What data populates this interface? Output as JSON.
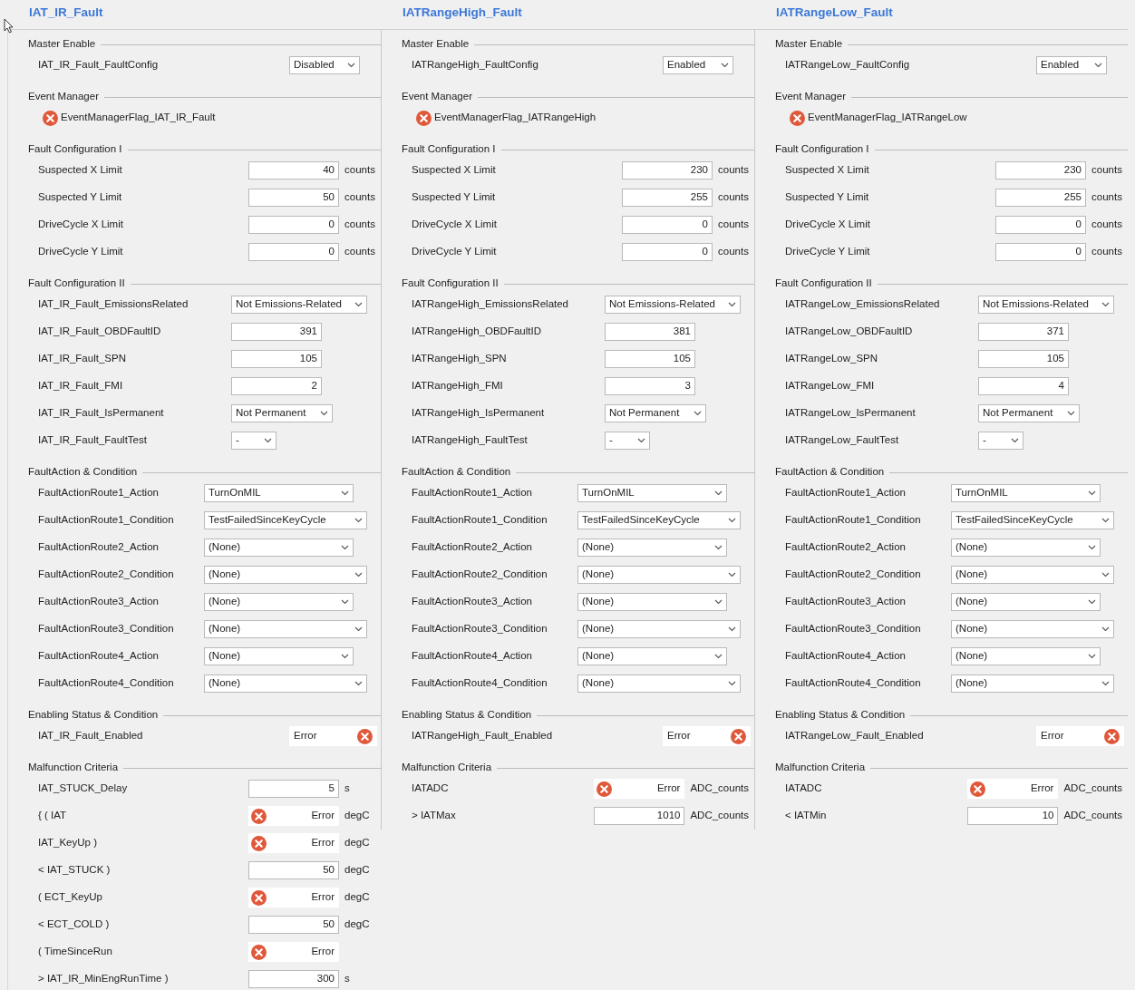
{
  "panels": [
    {
      "title": "IAT_IR_Fault",
      "sections": [
        {
          "title": "Master Enable",
          "rows": [
            {
              "kind": "select",
              "label": "IAT_IR_Fault_FaultConfig",
              "value": "Disabled"
            }
          ]
        },
        {
          "title": "Event Manager",
          "rows": [
            {
              "kind": "flag",
              "label": "EventManagerFlag_IAT_IR_Fault"
            }
          ]
        },
        {
          "title": "Fault Configuration I",
          "rows": [
            {
              "kind": "number",
              "label": "Suspected X Limit",
              "value": "40",
              "unit": "counts"
            },
            {
              "kind": "number",
              "label": "Suspected Y Limit",
              "value": "50",
              "unit": "counts"
            },
            {
              "kind": "number",
              "label": "DriveCycle X Limit",
              "value": "0",
              "unit": "counts"
            },
            {
              "kind": "number",
              "label": "DriveCycle Y Limit",
              "value": "0",
              "unit": "counts"
            }
          ]
        },
        {
          "title": "Fault Configuration II",
          "rows": [
            {
              "kind": "select",
              "label": "IAT_IR_Fault_EmissionsRelated",
              "value": "Not Emissions-Related"
            },
            {
              "kind": "number",
              "label": "IAT_IR_Fault_OBDFaultID",
              "value": "391"
            },
            {
              "kind": "number",
              "label": "IAT_IR_Fault_SPN",
              "value": "105"
            },
            {
              "kind": "number",
              "label": "IAT_IR_Fault_FMI",
              "value": "2"
            },
            {
              "kind": "select",
              "label": "IAT_IR_Fault_IsPermanent",
              "value": "Not Permanent"
            },
            {
              "kind": "select",
              "label": "IAT_IR_Fault_FaultTest",
              "value": "-"
            }
          ]
        },
        {
          "title": "FaultAction & Condition",
          "rows": [
            {
              "kind": "select",
              "label": "FaultActionRoute1_Action",
              "value": "TurnOnMIL"
            },
            {
              "kind": "select",
              "label": "FaultActionRoute1_Condition",
              "value": "TestFailedSinceKeyCycle"
            },
            {
              "kind": "select",
              "label": "FaultActionRoute2_Action",
              "value": "(None)"
            },
            {
              "kind": "select",
              "label": "FaultActionRoute2_Condition",
              "value": "(None)"
            },
            {
              "kind": "select",
              "label": "FaultActionRoute3_Action",
              "value": "(None)"
            },
            {
              "kind": "select",
              "label": "FaultActionRoute3_Condition",
              "value": "(None)"
            },
            {
              "kind": "select",
              "label": "FaultActionRoute4_Action",
              "value": "(None)"
            },
            {
              "kind": "select",
              "label": "FaultActionRoute4_Condition",
              "value": "(None)"
            }
          ]
        },
        {
          "title": "Enabling Status & Condition",
          "rows": [
            {
              "kind": "status",
              "label": "IAT_IR_Fault_Enabled",
              "value": "Error"
            }
          ]
        },
        {
          "title": "Malfunction Criteria",
          "rows": [
            {
              "kind": "number",
              "label": "IAT_STUCK_Delay",
              "value": "5",
              "unit": "s"
            },
            {
              "kind": "error_value",
              "label": "{ ( IAT",
              "value": "Error",
              "unit": "degC"
            },
            {
              "kind": "error_value",
              "label": "IAT_KeyUp )",
              "value": "Error",
              "unit": "degC"
            },
            {
              "kind": "number",
              "label": "< IAT_STUCK )",
              "value": "50",
              "unit": "degC"
            },
            {
              "kind": "error_value",
              "label": "( ECT_KeyUp",
              "value": "Error",
              "unit": "degC"
            },
            {
              "kind": "number",
              "label": "< ECT_COLD )",
              "value": "50",
              "unit": "degC"
            },
            {
              "kind": "error_value",
              "label": "( TimeSinceRun",
              "value": "Error"
            },
            {
              "kind": "number",
              "label": "> IAT_IR_MinEngRunTime )",
              "value": "300",
              "unit": "s"
            }
          ]
        }
      ]
    },
    {
      "title": "IATRangeHigh_Fault",
      "sections": [
        {
          "title": "Master Enable",
          "rows": [
            {
              "kind": "select",
              "label": "IATRangeHigh_FaultConfig",
              "value": "Enabled"
            }
          ]
        },
        {
          "title": "Event Manager",
          "rows": [
            {
              "kind": "flag",
              "label": "EventManagerFlag_IATRangeHigh"
            }
          ]
        },
        {
          "title": "Fault Configuration I",
          "rows": [
            {
              "kind": "number",
              "label": "Suspected X Limit",
              "value": "230",
              "unit": "counts"
            },
            {
              "kind": "number",
              "label": "Suspected Y Limit",
              "value": "255",
              "unit": "counts"
            },
            {
              "kind": "number",
              "label": "DriveCycle X Limit",
              "value": "0",
              "unit": "counts"
            },
            {
              "kind": "number",
              "label": "DriveCycle Y Limit",
              "value": "0",
              "unit": "counts"
            }
          ]
        },
        {
          "title": "Fault Configuration II",
          "rows": [
            {
              "kind": "select",
              "label": "IATRangeHigh_EmissionsRelated",
              "value": "Not Emissions-Related"
            },
            {
              "kind": "number",
              "label": "IATRangeHigh_OBDFaultID",
              "value": "381"
            },
            {
              "kind": "number",
              "label": "IATRangeHigh_SPN",
              "value": "105"
            },
            {
              "kind": "number",
              "label": "IATRangeHigh_FMI",
              "value": "3"
            },
            {
              "kind": "select",
              "label": "IATRangeHigh_IsPermanent",
              "value": "Not Permanent"
            },
            {
              "kind": "select",
              "label": "IATRangeHigh_FaultTest",
              "value": "-"
            }
          ]
        },
        {
          "title": "FaultAction & Condition",
          "rows": [
            {
              "kind": "select",
              "label": "FaultActionRoute1_Action",
              "value": "TurnOnMIL"
            },
            {
              "kind": "select",
              "label": "FaultActionRoute1_Condition",
              "value": "TestFailedSinceKeyCycle"
            },
            {
              "kind": "select",
              "label": "FaultActionRoute2_Action",
              "value": "(None)"
            },
            {
              "kind": "select",
              "label": "FaultActionRoute2_Condition",
              "value": "(None)"
            },
            {
              "kind": "select",
              "label": "FaultActionRoute3_Action",
              "value": "(None)"
            },
            {
              "kind": "select",
              "label": "FaultActionRoute3_Condition",
              "value": "(None)"
            },
            {
              "kind": "select",
              "label": "FaultActionRoute4_Action",
              "value": "(None)"
            },
            {
              "kind": "select",
              "label": "FaultActionRoute4_Condition",
              "value": "(None)"
            }
          ]
        },
        {
          "title": "Enabling Status & Condition",
          "rows": [
            {
              "kind": "status",
              "label": "IATRangeHigh_Fault_Enabled",
              "value": "Error"
            }
          ]
        },
        {
          "title": "Malfunction Criteria",
          "rows": [
            {
              "kind": "error_value",
              "label": "IATADC",
              "value": "Error",
              "unit": "ADC_counts"
            },
            {
              "kind": "number",
              "label": "> IATMax",
              "value": "1010",
              "unit": "ADC_counts"
            }
          ]
        }
      ]
    },
    {
      "title": "IATRangeLow_Fault",
      "sections": [
        {
          "title": "Master Enable",
          "rows": [
            {
              "kind": "select",
              "label": "IATRangeLow_FaultConfig",
              "value": "Enabled"
            }
          ]
        },
        {
          "title": "Event Manager",
          "rows": [
            {
              "kind": "flag",
              "label": "EventManagerFlag_IATRangeLow"
            }
          ]
        },
        {
          "title": "Fault Configuration I",
          "rows": [
            {
              "kind": "number",
              "label": "Suspected X Limit",
              "value": "230",
              "unit": "counts"
            },
            {
              "kind": "number",
              "label": "Suspected Y Limit",
              "value": "255",
              "unit": "counts"
            },
            {
              "kind": "number",
              "label": "DriveCycle X Limit",
              "value": "0",
              "unit": "counts"
            },
            {
              "kind": "number",
              "label": "DriveCycle Y Limit",
              "value": "0",
              "unit": "counts"
            }
          ]
        },
        {
          "title": "Fault Configuration II",
          "rows": [
            {
              "kind": "select",
              "label": "IATRangeLow_EmissionsRelated",
              "value": "Not Emissions-Related"
            },
            {
              "kind": "number",
              "label": "IATRangeLow_OBDFaultID",
              "value": "371"
            },
            {
              "kind": "number",
              "label": "IATRangeLow_SPN",
              "value": "105"
            },
            {
              "kind": "number",
              "label": "IATRangeLow_FMI",
              "value": "4"
            },
            {
              "kind": "select",
              "label": "IATRangeLow_IsPermanent",
              "value": "Not Permanent"
            },
            {
              "kind": "select",
              "label": "IATRangeLow_FaultTest",
              "value": "-"
            }
          ]
        },
        {
          "title": "FaultAction & Condition",
          "rows": [
            {
              "kind": "select",
              "label": "FaultActionRoute1_Action",
              "value": "TurnOnMIL"
            },
            {
              "kind": "select",
              "label": "FaultActionRoute1_Condition",
              "value": "TestFailedSinceKeyCycle"
            },
            {
              "kind": "select",
              "label": "FaultActionRoute2_Action",
              "value": "(None)"
            },
            {
              "kind": "select",
              "label": "FaultActionRoute2_Condition",
              "value": "(None)"
            },
            {
              "kind": "select",
              "label": "FaultActionRoute3_Action",
              "value": "(None)"
            },
            {
              "kind": "select",
              "label": "FaultActionRoute3_Condition",
              "value": "(None)"
            },
            {
              "kind": "select",
              "label": "FaultActionRoute4_Action",
              "value": "(None)"
            },
            {
              "kind": "select",
              "label": "FaultActionRoute4_Condition",
              "value": "(None)"
            }
          ]
        },
        {
          "title": "Enabling Status & Condition",
          "rows": [
            {
              "kind": "status",
              "label": "IATRangeLow_Fault_Enabled",
              "value": "Error"
            }
          ]
        },
        {
          "title": "Malfunction Criteria",
          "rows": [
            {
              "kind": "error_value",
              "label": "IATADC",
              "value": "Error",
              "unit": "ADC_counts"
            },
            {
              "kind": "number",
              "label": "< IATMin",
              "value": "10",
              "unit": "ADC_counts"
            }
          ]
        }
      ]
    }
  ]
}
